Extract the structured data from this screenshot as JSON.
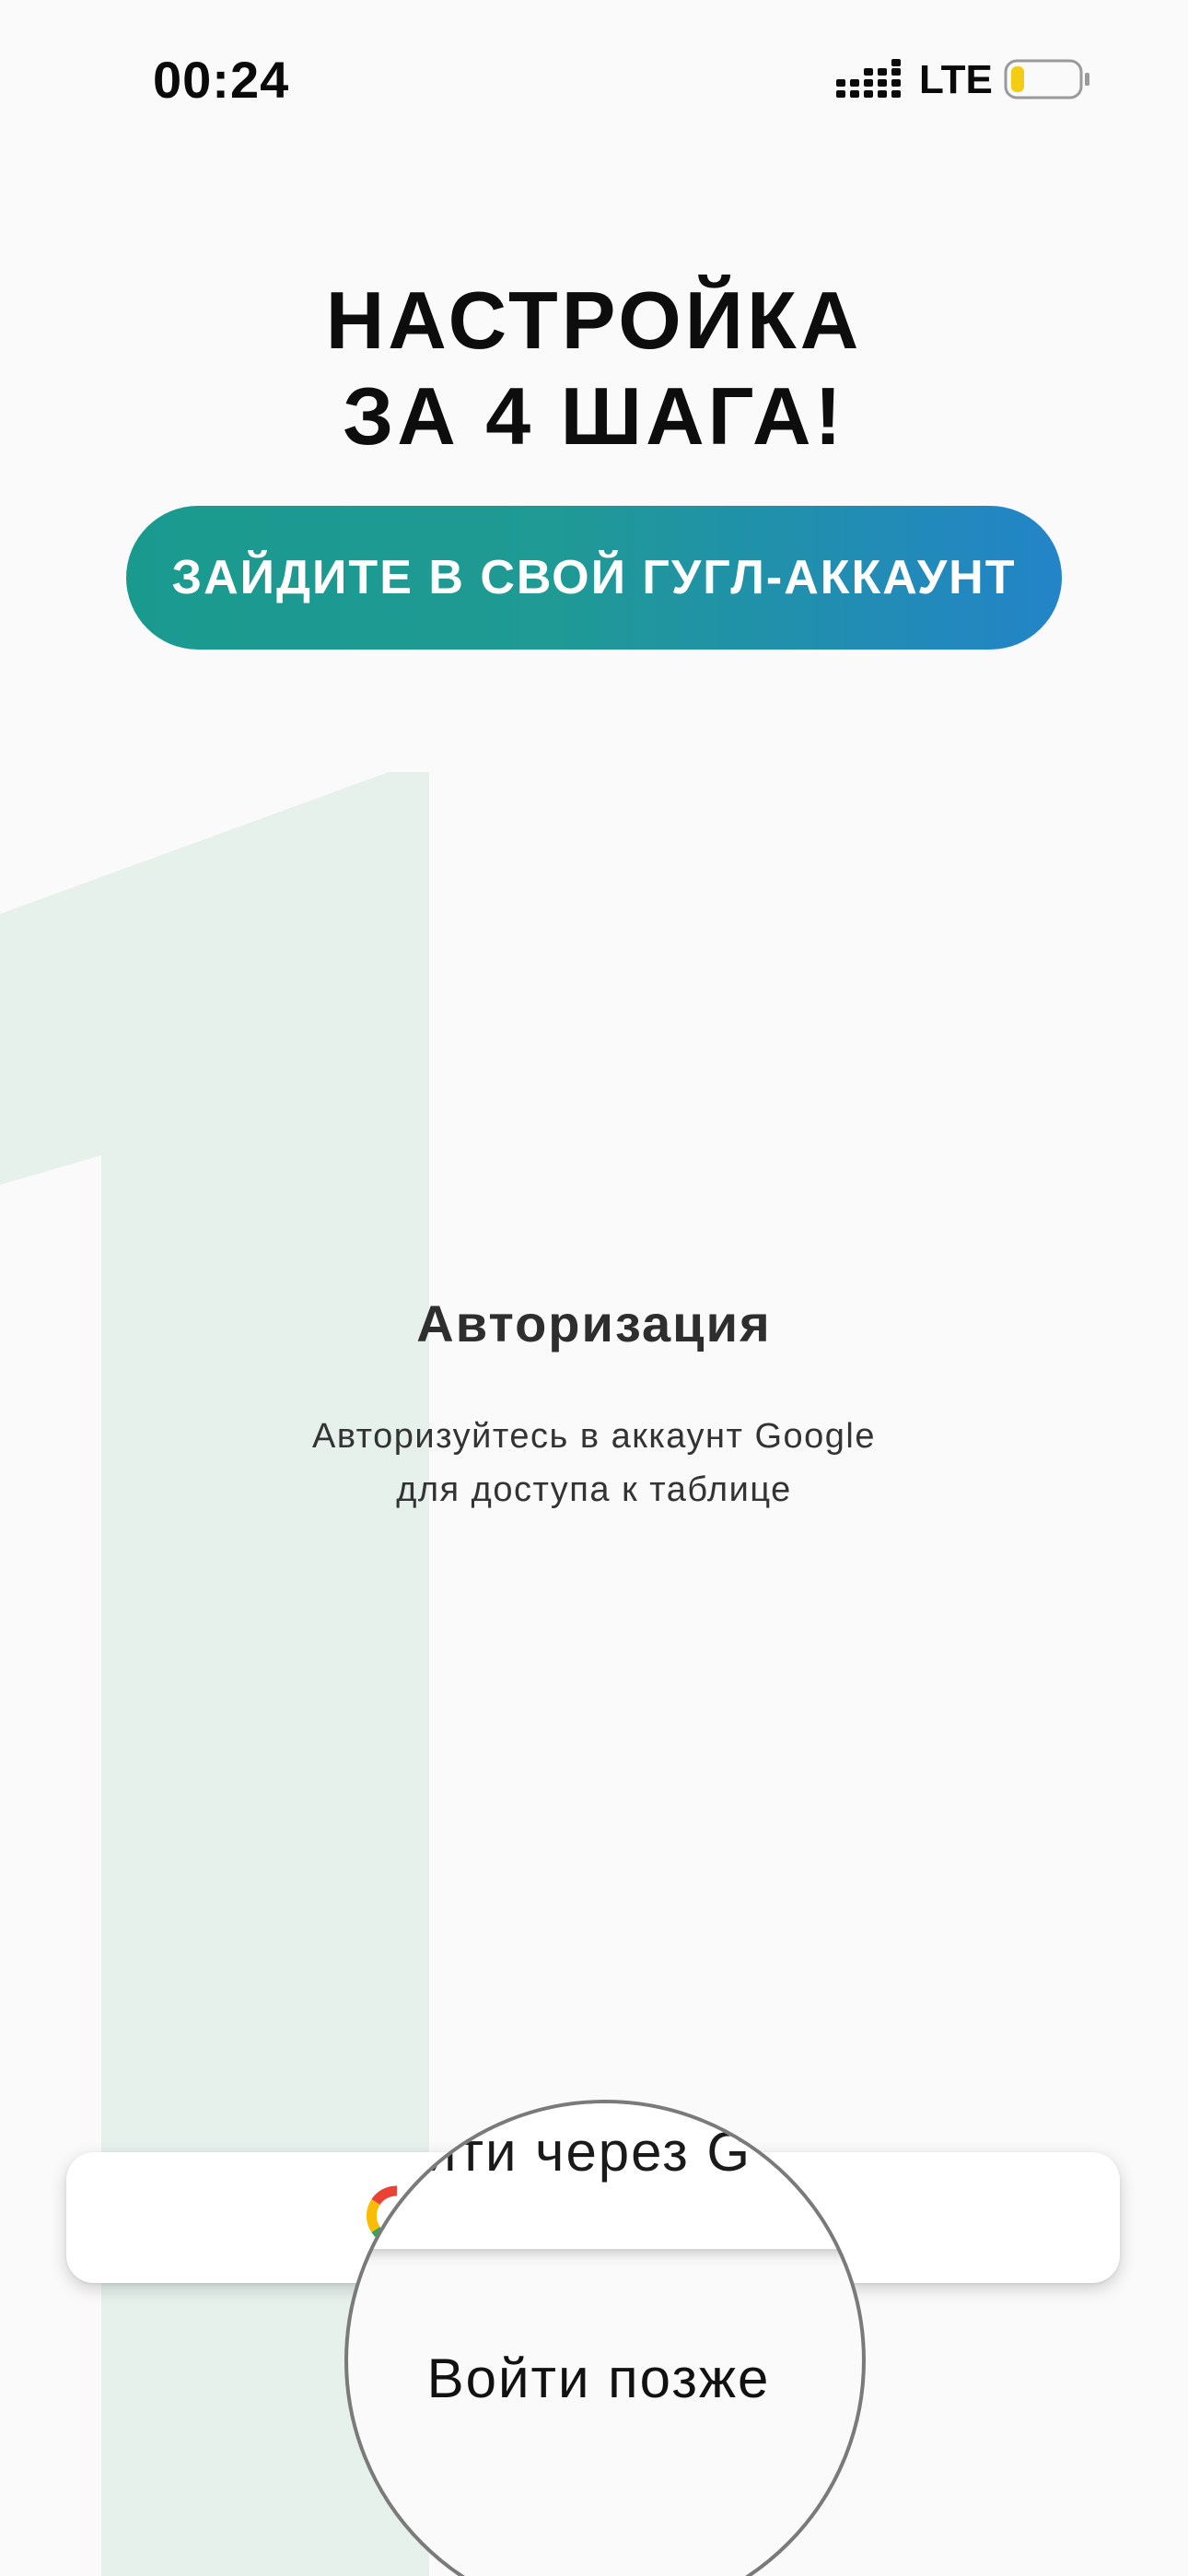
{
  "status_bar": {
    "time": "00:24",
    "network": "LTE",
    "signal_icon": "signal-bars-icon",
    "battery_icon": "battery-low-icon",
    "battery_level": 0.15
  },
  "title": {
    "line1": "НАСТРОЙКА",
    "line2": "ЗА 4 ШАГА!"
  },
  "step": {
    "number": "1",
    "pill_label": "ЗАЙДИТЕ В СВОЙ ГУГЛ-АККАУНТ",
    "heading": "Авторизация",
    "description_line1": "Авторизуйтесь в аккаунт Google",
    "description_line2": "для доступа к таблице"
  },
  "actions": {
    "google_button_label": "Войти через Google",
    "google_button_visible_label": "йти через G",
    "google_icon": "google-logo-icon",
    "later_label": "Войти позже"
  },
  "colors": {
    "background": "#fafafa",
    "pill_gradient_start": "#1a9a8f",
    "pill_gradient_end": "#2384c8",
    "big_number": "#e6f1ec",
    "battery_fill": "#f5cc14"
  }
}
